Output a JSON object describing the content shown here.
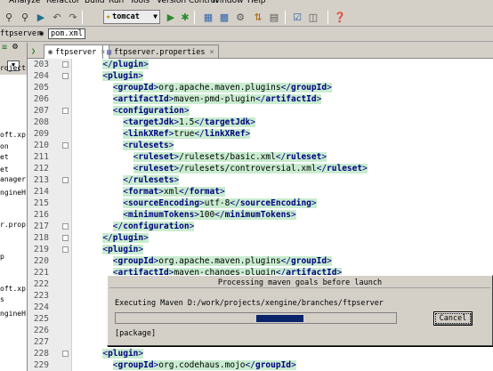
{
  "menubar": {
    "items": [
      "Analyze",
      "Refactor",
      "Build",
      "Run",
      "Tools",
      "Version Control",
      "Window",
      "Help"
    ]
  },
  "toolbar": {
    "run_config": "tomcat",
    "icons": [
      "search-icon",
      "search-replace-icon",
      "navigate-icon",
      "back-icon",
      "forward-icon",
      "tomcat-icon",
      "run-icon",
      "debug-icon",
      "build-icon",
      "project-structure-icon",
      "settings-icon",
      "vcs-icon",
      "open-icon",
      "tasks-icon",
      "view-icon",
      "help-icon"
    ]
  },
  "breadcrumb": {
    "items": [
      "ftpserver",
      "pom.xml"
    ]
  },
  "left_panel": {
    "fragments": [
      "roject",
      "oft.xp",
      "on",
      "et",
      "et",
      "anager",
      "ngineH",
      "r.prop",
      "p",
      "oft.xp",
      "s",
      "ngineH"
    ]
  },
  "tabs": [
    {
      "label": "ftpserver",
      "close": "×"
    },
    {
      "label": "ftpserver.properties",
      "close": "×"
    }
  ],
  "editor": {
    "lines": [
      {
        "num": "203",
        "indent": "      ",
        "parts": [
          [
            "br",
            "</"
          ],
          [
            "tag",
            "plugin"
          ],
          [
            "br",
            ">"
          ]
        ]
      },
      {
        "num": "204",
        "indent": "      ",
        "parts": [
          [
            "br",
            "<"
          ],
          [
            "tag",
            "plugin"
          ],
          [
            "br",
            ">"
          ]
        ]
      },
      {
        "num": "205",
        "indent": "        ",
        "parts": [
          [
            "br",
            "<"
          ],
          [
            "tag",
            "groupId"
          ],
          [
            "br",
            ">"
          ],
          [
            "txt",
            "org.apache.maven.plugins"
          ],
          [
            "br",
            "</"
          ],
          [
            "tag",
            "groupId"
          ],
          [
            "br",
            ">"
          ]
        ]
      },
      {
        "num": "206",
        "indent": "        ",
        "parts": [
          [
            "br",
            "<"
          ],
          [
            "tag",
            "artifactId"
          ],
          [
            "br",
            ">"
          ],
          [
            "txt",
            "maven-pmd-plugin"
          ],
          [
            "br",
            "</"
          ],
          [
            "tag",
            "artifactId"
          ],
          [
            "br",
            ">"
          ]
        ]
      },
      {
        "num": "207",
        "indent": "        ",
        "parts": [
          [
            "br",
            "<"
          ],
          [
            "tag",
            "configuration"
          ],
          [
            "br",
            ">"
          ]
        ]
      },
      {
        "num": "208",
        "indent": "          ",
        "parts": [
          [
            "br",
            "<"
          ],
          [
            "tag",
            "targetJdk"
          ],
          [
            "br",
            ">"
          ],
          [
            "txt",
            "1.5"
          ],
          [
            "br",
            "</"
          ],
          [
            "tag",
            "targetJdk"
          ],
          [
            "br",
            ">"
          ]
        ]
      },
      {
        "num": "209",
        "indent": "          ",
        "parts": [
          [
            "br",
            "<"
          ],
          [
            "tag",
            "linkXRef"
          ],
          [
            "br",
            ">"
          ],
          [
            "txt",
            "true"
          ],
          [
            "br",
            "</"
          ],
          [
            "tag",
            "linkXRef"
          ],
          [
            "br",
            ">"
          ]
        ]
      },
      {
        "num": "210",
        "indent": "          ",
        "parts": [
          [
            "br",
            "<"
          ],
          [
            "tag",
            "rulesets"
          ],
          [
            "br",
            ">"
          ]
        ]
      },
      {
        "num": "211",
        "indent": "            ",
        "parts": [
          [
            "br",
            "<"
          ],
          [
            "tag",
            "ruleset"
          ],
          [
            "br",
            ">"
          ],
          [
            "txt",
            "/rulesets/basic.xml"
          ],
          [
            "br",
            "</"
          ],
          [
            "tag",
            "ruleset"
          ],
          [
            "br",
            ">"
          ]
        ]
      },
      {
        "num": "212",
        "indent": "            ",
        "parts": [
          [
            "br",
            "<"
          ],
          [
            "tag",
            "ruleset"
          ],
          [
            "br",
            ">"
          ],
          [
            "txt",
            "/rulesets/controversial.xml"
          ],
          [
            "br",
            "</"
          ],
          [
            "tag",
            "ruleset"
          ],
          [
            "br",
            ">"
          ]
        ]
      },
      {
        "num": "213",
        "indent": "          ",
        "parts": [
          [
            "br",
            "</"
          ],
          [
            "tag",
            "rulesets"
          ],
          [
            "br",
            ">"
          ]
        ]
      },
      {
        "num": "214",
        "indent": "          ",
        "parts": [
          [
            "br",
            "<"
          ],
          [
            "tag",
            "format"
          ],
          [
            "br",
            ">"
          ],
          [
            "txt",
            "xml"
          ],
          [
            "br",
            "</"
          ],
          [
            "tag",
            "format"
          ],
          [
            "br",
            ">"
          ]
        ]
      },
      {
        "num": "215",
        "indent": "          ",
        "parts": [
          [
            "br",
            "<"
          ],
          [
            "tag",
            "sourceEncoding"
          ],
          [
            "br",
            ">"
          ],
          [
            "txt",
            "utf-8"
          ],
          [
            "br",
            "</"
          ],
          [
            "tag",
            "sourceEncoding"
          ],
          [
            "br",
            ">"
          ]
        ]
      },
      {
        "num": "216",
        "indent": "          ",
        "parts": [
          [
            "br",
            "<"
          ],
          [
            "tag",
            "minimumTokens"
          ],
          [
            "br",
            ">"
          ],
          [
            "txt",
            "100"
          ],
          [
            "br",
            "</"
          ],
          [
            "tag",
            "minimumTokens"
          ],
          [
            "br",
            ">"
          ]
        ]
      },
      {
        "num": "217",
        "indent": "        ",
        "parts": [
          [
            "br",
            "</"
          ],
          [
            "tag",
            "configuration"
          ],
          [
            "br",
            ">"
          ]
        ]
      },
      {
        "num": "218",
        "indent": "      ",
        "parts": [
          [
            "br",
            "</"
          ],
          [
            "tag",
            "plugin"
          ],
          [
            "br",
            ">"
          ]
        ]
      },
      {
        "num": "219",
        "indent": "      ",
        "parts": [
          [
            "br",
            "<"
          ],
          [
            "tag",
            "plugin"
          ],
          [
            "br",
            ">"
          ]
        ]
      },
      {
        "num": "220",
        "indent": "        ",
        "parts": [
          [
            "br",
            "<"
          ],
          [
            "tag",
            "groupId"
          ],
          [
            "br",
            ">"
          ],
          [
            "txt",
            "org.apache.maven.plugins"
          ],
          [
            "br",
            "</"
          ],
          [
            "tag",
            "groupId"
          ],
          [
            "br",
            ">"
          ]
        ]
      },
      {
        "num": "221",
        "indent": "        ",
        "parts": [
          [
            "br",
            "<"
          ],
          [
            "tag",
            "artifactId"
          ],
          [
            "br",
            ">"
          ],
          [
            "txt",
            "maven-changes-plugin"
          ],
          [
            "br",
            "</"
          ],
          [
            "tag",
            "artifactId"
          ],
          [
            "br",
            ">"
          ]
        ]
      },
      {
        "num": "222",
        "indent": "",
        "parts": []
      },
      {
        "num": "223",
        "indent": "",
        "parts": []
      },
      {
        "num": "224",
        "indent": "",
        "parts": []
      },
      {
        "num": "225",
        "indent": "",
        "parts": []
      },
      {
        "num": "226",
        "indent": "",
        "parts": []
      },
      {
        "num": "227",
        "indent": "",
        "parts": []
      },
      {
        "num": "228",
        "indent": "      ",
        "parts": [
          [
            "br",
            "<"
          ],
          [
            "tag",
            "plugin"
          ],
          [
            "br",
            ">"
          ]
        ]
      },
      {
        "num": "229",
        "indent": "        ",
        "parts": [
          [
            "br",
            "<"
          ],
          [
            "tag",
            "groupId"
          ],
          [
            "br",
            ">"
          ],
          [
            "txt",
            "org.codehaus.mojo"
          ],
          [
            "br",
            "</"
          ],
          [
            "tag",
            "groupId"
          ],
          [
            "br",
            ">"
          ]
        ]
      }
    ]
  },
  "dialog": {
    "title": "Processing maven goals before launch",
    "message": "Executing Maven D:/work/projects/xengine/branches/ftpserver",
    "progress_start": 0.5,
    "progress_end": 0.67,
    "cancel_label": "Cancel",
    "goals": "[package]"
  }
}
